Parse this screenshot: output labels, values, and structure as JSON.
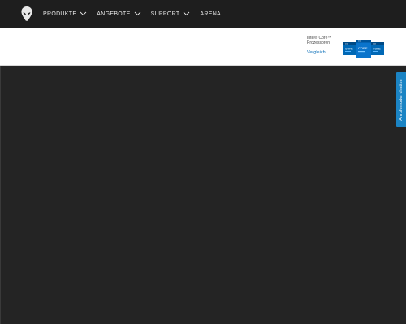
{
  "nav": {
    "items": [
      {
        "label": "PRODUKTE",
        "has_dropdown": true
      },
      {
        "label": "ANGEBOTE",
        "has_dropdown": true
      },
      {
        "label": "SUPPORT",
        "has_dropdown": true
      },
      {
        "label": "ARENA",
        "has_dropdown": false
      }
    ],
    "logo_icon": "alien-head-logo"
  },
  "promo": {
    "line1": "Intel® Core™",
    "line2": "Prozessoren",
    "compare_link": "Vergleich",
    "badge_icons": [
      "intel-core-i5-badge",
      "intel-core-i7-badge",
      "intel-core-i9-badge"
    ]
  },
  "side_tab": {
    "label": "Anrufen oder chatten"
  },
  "colors": {
    "nav_bg": "#1e1e1e",
    "hero_bg": "#242424",
    "accent_blue": "#1b84c4",
    "link_blue": "#0b6fb8",
    "badge_blue": "#0068b5"
  }
}
